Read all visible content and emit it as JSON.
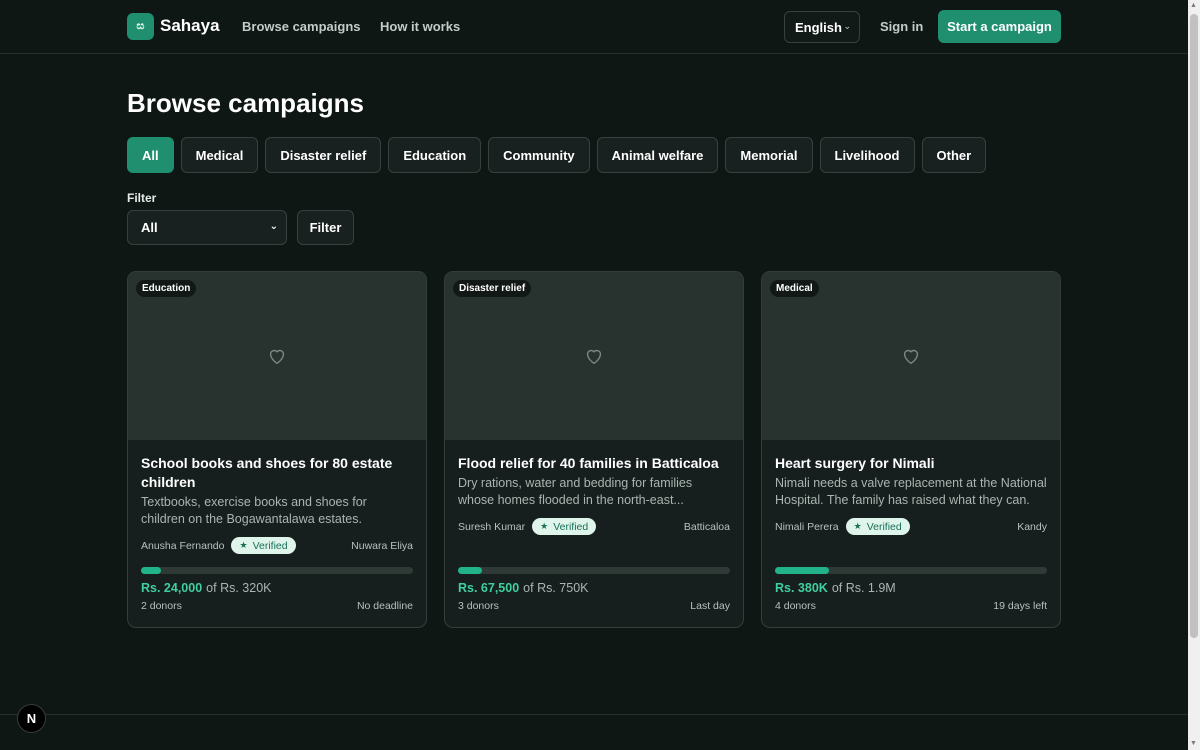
{
  "header": {
    "logo_mark": "ස",
    "brand": "Sahaya",
    "nav": [
      "Browse campaigns",
      "How it works"
    ],
    "language": "English",
    "sign_in": "Sign in",
    "start_campaign": "Start a campaign"
  },
  "page": {
    "title": "Browse campaigns",
    "categories": [
      "All",
      "Medical",
      "Disaster relief",
      "Education",
      "Community",
      "Animal welfare",
      "Memorial",
      "Livelihood",
      "Other"
    ],
    "active_category": "All",
    "filter_label": "Filter",
    "filter_value": "All",
    "filter_button": "Filter"
  },
  "campaigns": [
    {
      "category": "Education",
      "title": "School books and shoes for 80 estate children",
      "description": "Textbooks, exercise books and shoes for children on the Bogawantalawa estates.",
      "organizer": "Anusha Fernando",
      "verified": "Verified",
      "location": "Nuwara Eliya",
      "raised": "Rs. 24,000",
      "goal": "of Rs. 320K",
      "progress": 0.075,
      "donors": "2 donors",
      "deadline": "No deadline"
    },
    {
      "category": "Disaster relief",
      "title": "Flood relief for 40 families in Batticaloa",
      "description": "Dry rations, water and bedding for families whose homes flooded in the north-east...",
      "organizer": "Suresh Kumar",
      "verified": "Verified",
      "location": "Batticaloa",
      "raised": "Rs. 67,500",
      "goal": "of Rs. 750K",
      "progress": 0.09,
      "donors": "3 donors",
      "deadline": "Last day"
    },
    {
      "category": "Medical",
      "title": "Heart surgery for Nimali",
      "description": "Nimali needs a valve replacement at the National Hospital. The family has raised what they can.",
      "organizer": "Nimali Perera",
      "verified": "Verified",
      "location": "Kandy",
      "raised": "Rs. 380K",
      "goal": "of Rs. 1.9M",
      "progress": 0.2,
      "donors": "4 donors",
      "deadline": "19 days left"
    }
  ],
  "dev_badge": "N",
  "icons": {
    "heart": "heart-icon",
    "star": "star-icon",
    "chevron": "chevron-down-icon"
  }
}
